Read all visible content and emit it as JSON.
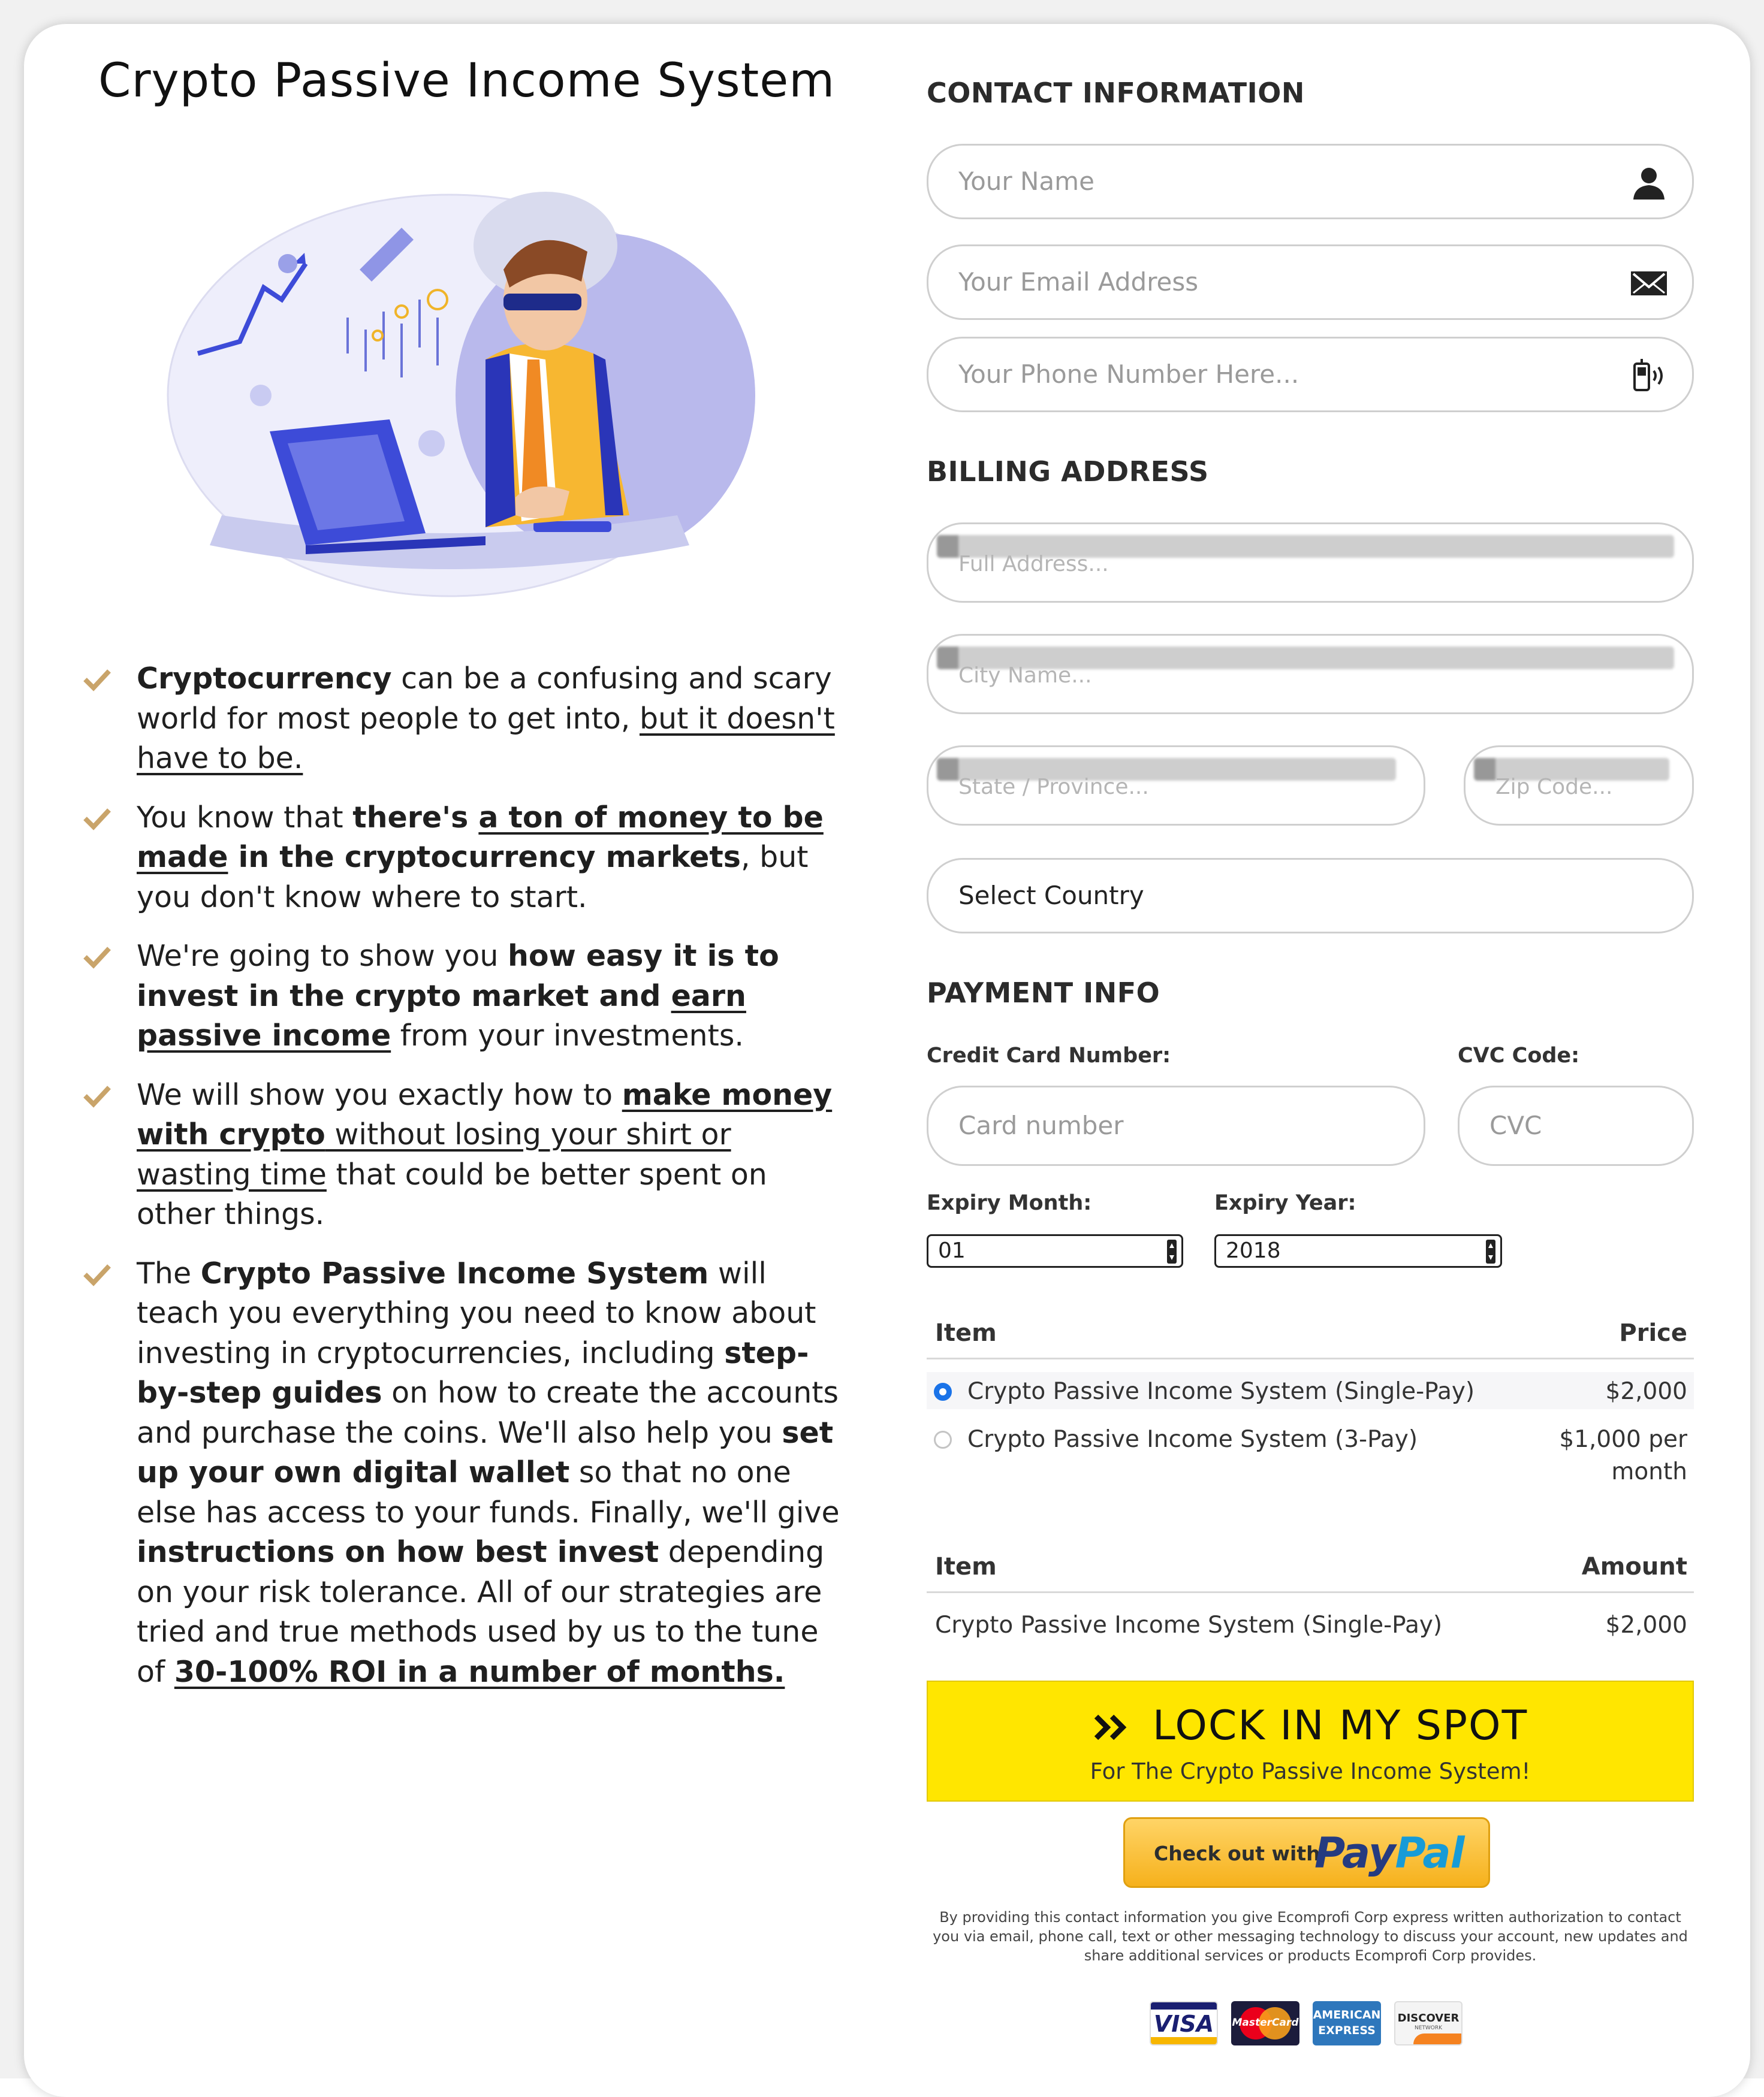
{
  "page": {
    "title": "Crypto Passive Income System"
  },
  "bullets": [
    {
      "parts": [
        {
          "t": "Cryptocurrency",
          "b": true
        },
        {
          "t": " can be a confusing and scary world for most people to get into, "
        },
        {
          "t": "but it doesn't have to be.",
          "u": true
        }
      ]
    },
    {
      "parts": [
        {
          "t": "You know that "
        },
        {
          "t": "there's ",
          "b": true
        },
        {
          "t": "a ton of money to be made",
          "b": true,
          "u": true
        },
        {
          "t": " in the cryptocurrency markets",
          "b": true
        },
        {
          "t": ", but you don't know where to start."
        }
      ]
    },
    {
      "parts": [
        {
          "t": "We're going to show you "
        },
        {
          "t": "how easy it is to invest in the crypto market and ",
          "b": true
        },
        {
          "t": "earn passive income",
          "b": true,
          "u": true
        },
        {
          "t": " from your investments."
        }
      ]
    },
    {
      "parts": [
        {
          "t": "We will show you exactly how to "
        },
        {
          "t": "make money with crypto",
          "b": true,
          "u": true
        },
        {
          "t": " without losing your shirt or wasting time",
          "u": true
        },
        {
          "t": " that could be better spent on other things."
        }
      ]
    },
    {
      "parts": [
        {
          "t": "The "
        },
        {
          "t": "Crypto Passive Income System",
          "b": true
        },
        {
          "t": " will teach you everything you need to know about investing in cryptocurrencies, including "
        },
        {
          "t": "step-by-step guides",
          "b": true
        },
        {
          "t": " on how to create the accounts and purchase the coins. We'll also help you "
        },
        {
          "t": "set up your own digital wallet",
          "b": true
        },
        {
          "t": " so that no one else has access to your funds. Finally, we'll give "
        },
        {
          "t": "instructions on how best invest",
          "b": true
        },
        {
          "t": " depending on your risk tolerance. All of our strategies are tried and true methods used by us to the tune of "
        },
        {
          "t": "30-100% ROI in a number of months.",
          "b": true,
          "u": true
        }
      ]
    }
  ],
  "contact": {
    "heading": "CONTACT INFORMATION",
    "name_placeholder": "Your Name",
    "email_placeholder": "Your Email Address",
    "phone_placeholder": "Your Phone Number Here..."
  },
  "billing": {
    "heading": "BILLING ADDRESS",
    "address_placeholder": "Full Address...",
    "city_placeholder": "City Name...",
    "state_placeholder": "State / Province...",
    "zip_placeholder": "Zip Code...",
    "country_value": "Select Country"
  },
  "payment": {
    "heading": "PAYMENT INFO",
    "card_label": "Credit Card Number:",
    "card_placeholder": "Card number",
    "cvc_label": "CVC Code:",
    "cvc_placeholder": "CVC",
    "month_label": "Expiry Month:",
    "month_value": "01",
    "year_label": "Expiry Year:",
    "year_value": "2018"
  },
  "products": {
    "col_item": "Item",
    "col_price": "Price",
    "rows": [
      {
        "name": "Crypto Passive Income System (Single-Pay)",
        "price": "$2,000",
        "selected": true
      },
      {
        "name": "Crypto Passive Income System (3-Pay)",
        "price_line1": "$1,000 per",
        "price_line2": "month",
        "selected": false
      }
    ]
  },
  "summary": {
    "col_item": "Item",
    "col_amount": "Amount",
    "row_name": "Crypto Passive Income System (Single-Pay)",
    "row_amount": "$2,000"
  },
  "cta": {
    "main": "LOCK IN MY SPOT",
    "sub": "For The Crypto Passive Income System!",
    "icon": "double-chevron-right-icon"
  },
  "paypal": {
    "prefix": "Check out with",
    "brand_pay": "Pay",
    "brand_pal": "Pal"
  },
  "legal": "By providing this contact information you give Ecomprofi Corp express written authorization to contact you via email, phone call, text or other messaging technology to discuss your account, new updates and share additional services or products Ecomprofi Corp provides.",
  "card_logos": {
    "visa": "VISA",
    "mastercard": "MasterCard",
    "amex_line1": "AMERICAN",
    "amex_line2": "EXPRESS",
    "discover": "DISCOVER",
    "discover_sub": "NETWORK"
  },
  "colors": {
    "check": "#c9a46a",
    "cta_yellow": "#ffe600",
    "radio_selected": "#1a73e8",
    "paypal_dark": "#253b80",
    "paypal_light": "#179bd7"
  }
}
